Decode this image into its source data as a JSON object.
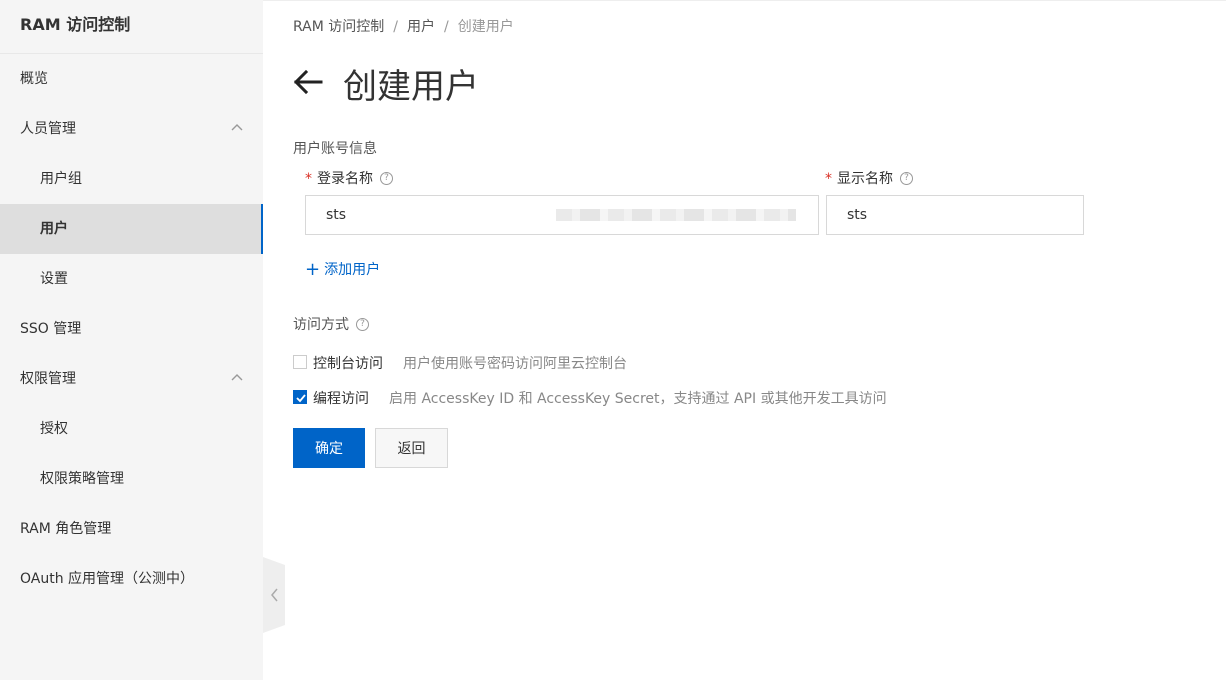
{
  "sidebar": {
    "title": "RAM 访问控制",
    "items": [
      {
        "label": "概览"
      },
      {
        "label": "人员管理"
      },
      {
        "label": "用户组"
      },
      {
        "label": "用户"
      },
      {
        "label": "设置"
      },
      {
        "label": "SSO 管理"
      },
      {
        "label": "权限管理"
      },
      {
        "label": "授权"
      },
      {
        "label": "权限策略管理"
      },
      {
        "label": "RAM 角色管理"
      },
      {
        "label": "OAuth 应用管理（公测中）"
      }
    ]
  },
  "breadcrumb": {
    "items": [
      "RAM 访问控制",
      "用户",
      "创建用户"
    ],
    "separator": "/"
  },
  "page": {
    "title": "创建用户"
  },
  "form": {
    "account_section_label": "用户账号信息",
    "login_name": {
      "label": "登录名称",
      "value": "sts"
    },
    "display_name": {
      "label": "显示名称",
      "value": "sts"
    },
    "required_mark": "*",
    "help_glyph": "?",
    "add_user_label": "添加用户",
    "add_user_glyph": "+",
    "access_section_label": "访问方式",
    "console_access": {
      "label": "控制台访问",
      "description": "用户使用账号密码访问阿里云控制台",
      "checked": false
    },
    "programmatic_access": {
      "label": "编程访问",
      "description": "启用 AccessKey ID 和 AccessKey Secret，支持通过 API 或其他开发工具访问",
      "checked": true
    },
    "confirm_label": "确定",
    "back_label": "返回"
  },
  "colors": {
    "primary": "#0064c8",
    "required": "#d93026",
    "sidebar_bg": "#f5f5f5"
  },
  "icons": {
    "back": "arrow-left-icon",
    "expand": "chevron-up-icon",
    "help": "question-circle-icon",
    "collapse": "chevron-left-icon"
  }
}
